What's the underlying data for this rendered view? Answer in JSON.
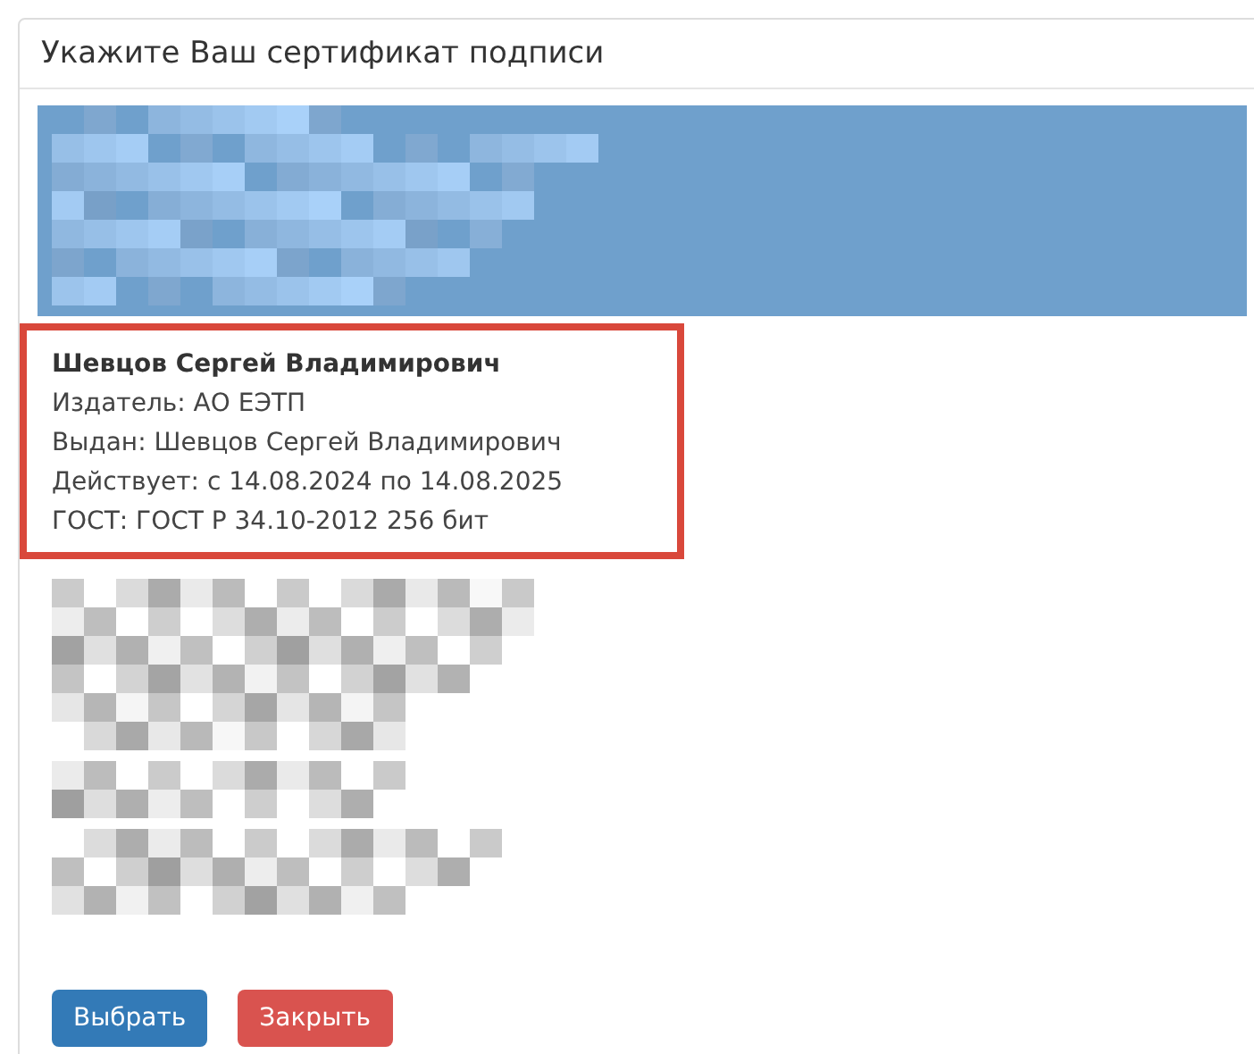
{
  "dialog": {
    "title": "Укажите Ваш сертификат подписи"
  },
  "certificates": [
    {
      "kind": "redacted",
      "selected": true,
      "highlighted": false
    },
    {
      "kind": "shown",
      "selected": false,
      "highlighted": true,
      "name": "Шевцов Сергей Владимирович",
      "lines": [
        "Издатель: АО ЕЭТП",
        "Выдан: Шевцов Сергей Владимирович",
        "Действует: с 14.08.2024 по 14.08.2025",
        "ГОСТ: ГОСТ Р 34.10-2012 256 бит"
      ]
    },
    {
      "kind": "redacted",
      "selected": false,
      "highlighted": false
    },
    {
      "kind": "redacted",
      "selected": false,
      "highlighted": false
    },
    {
      "kind": "redacted",
      "selected": false,
      "highlighted": false
    }
  ],
  "buttons": [
    {
      "label": "Выбрать",
      "kind": "primary"
    },
    {
      "label": "Закрыть",
      "kind": "danger"
    }
  ]
}
